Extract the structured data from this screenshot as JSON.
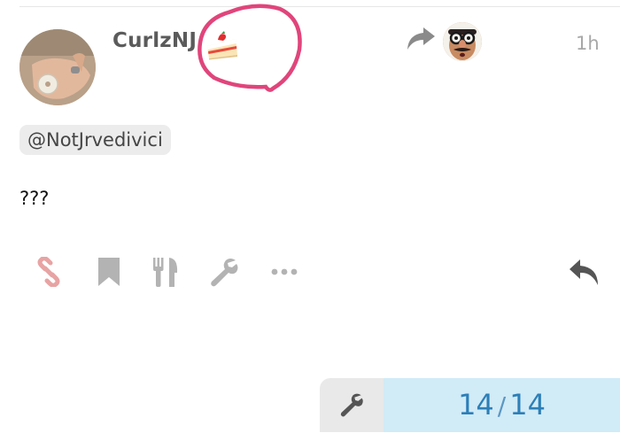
{
  "post": {
    "username": "CurlzNJ",
    "flair_emoji": "strawberry-shortcake",
    "annotation_color": "#e0457b",
    "reply_to_icon": "share-arrow-icon",
    "age": "1h",
    "mention": "@NotJrvedivici",
    "body": "???"
  },
  "actions": [
    {
      "icon": "link-icon",
      "color": "#e8a3a3"
    },
    {
      "icon": "bookmark-icon",
      "color": "#b3b3b3"
    },
    {
      "icon": "fork-knife-icon",
      "color": "#b3b3b3"
    },
    {
      "icon": "wrench-icon",
      "color": "#b3b3b3"
    },
    {
      "icon": "more-icon",
      "color": "#b3b3b3"
    },
    {
      "icon": "reply-icon",
      "color": "#555555"
    }
  ],
  "footer": {
    "admin_icon": "wrench-icon",
    "progress_current": "14",
    "progress_separator": "/",
    "progress_total": "14",
    "progress_bg": "#d1ebf7",
    "progress_color": "#2c7fb8"
  }
}
